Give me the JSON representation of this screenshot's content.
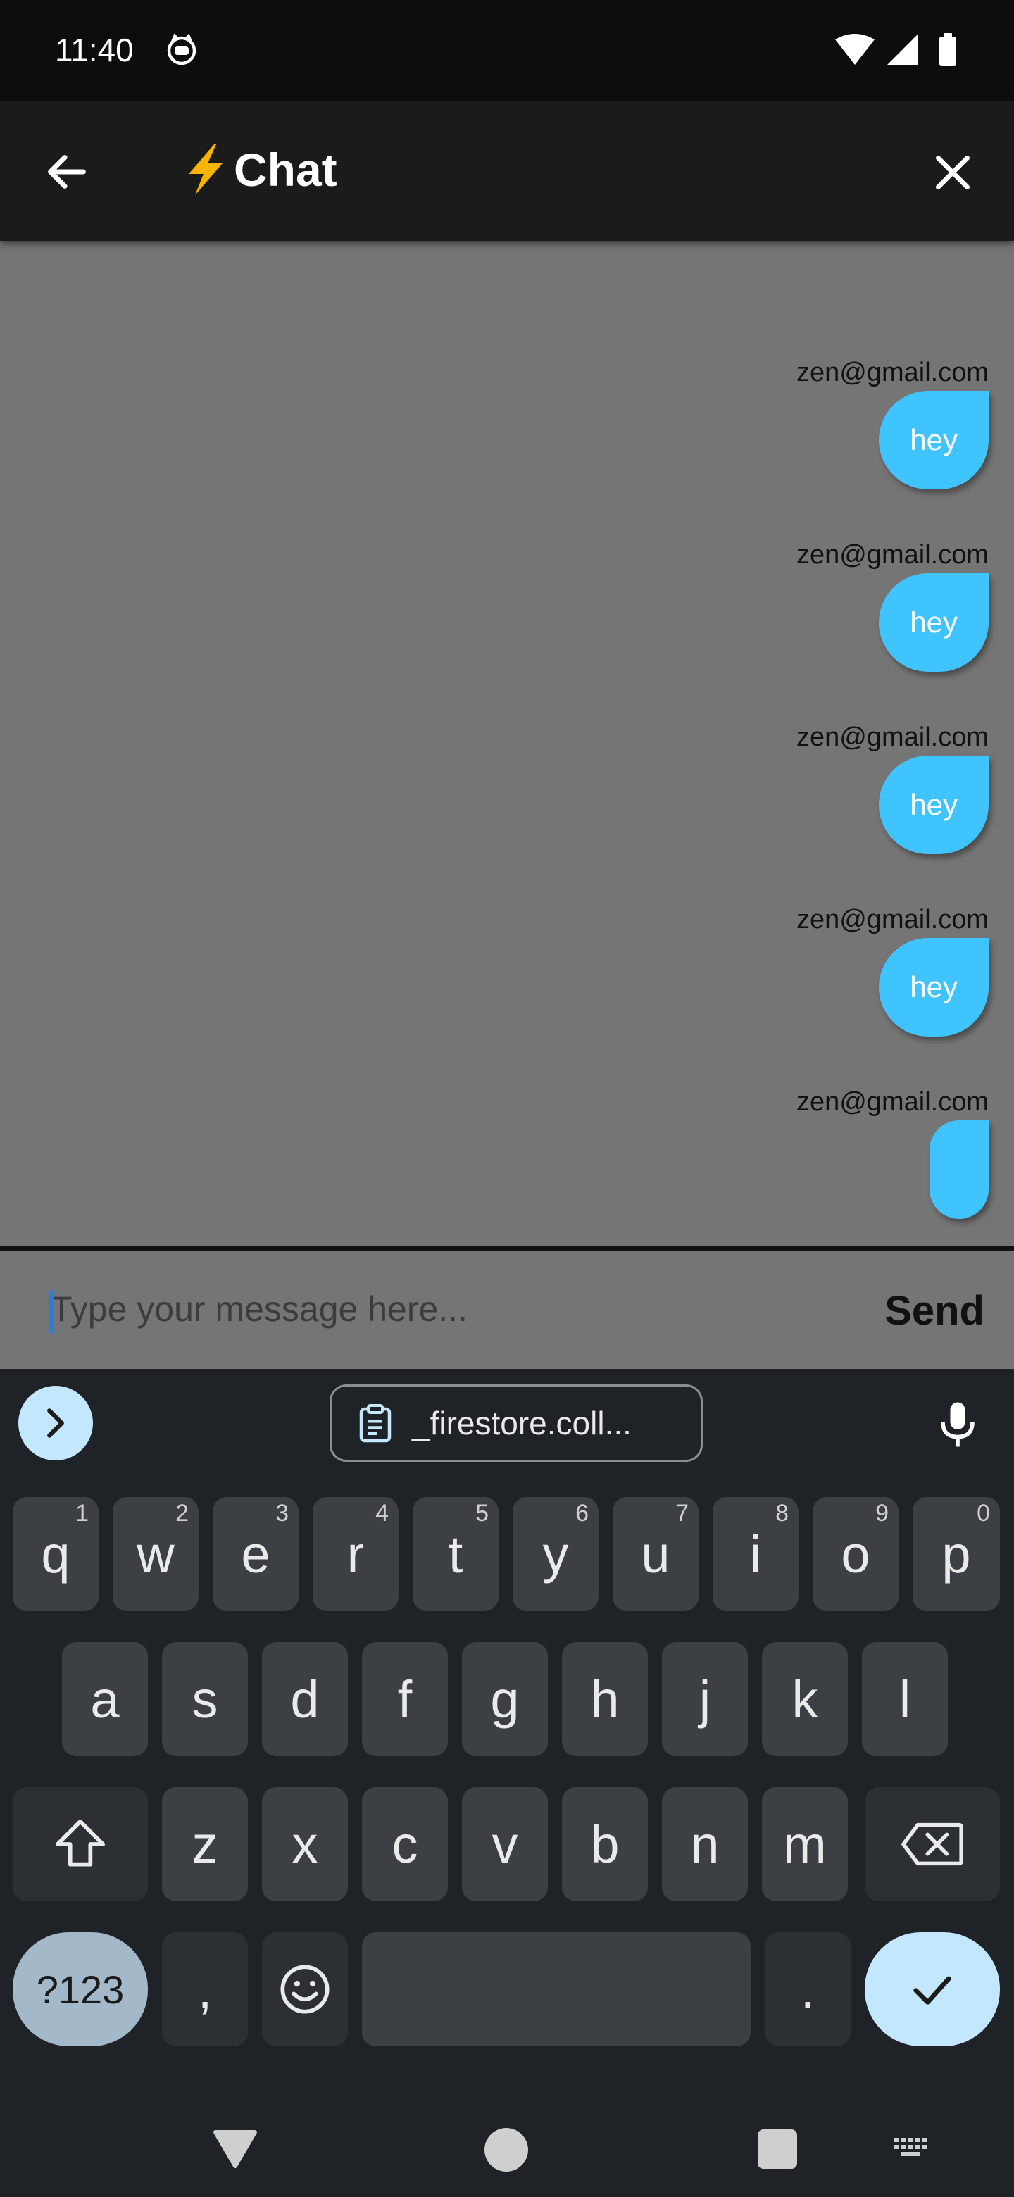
{
  "status_bar": {
    "time": "11:40"
  },
  "app_bar": {
    "title": "Chat"
  },
  "messages": [
    {
      "sender": "zen@gmail.com",
      "text": "hey"
    },
    {
      "sender": "zen@gmail.com",
      "text": "hey"
    },
    {
      "sender": "zen@gmail.com",
      "text": "hey"
    },
    {
      "sender": "zen@gmail.com",
      "text": "hey"
    },
    {
      "sender": "zen@gmail.com",
      "text": ""
    }
  ],
  "composer": {
    "placeholder": "Type your message here...",
    "send_label": "Send"
  },
  "keyboard": {
    "clipboard_suggestion": "_firestore.coll...",
    "row1": [
      {
        "key": "q",
        "hint": "1"
      },
      {
        "key": "w",
        "hint": "2"
      },
      {
        "key": "e",
        "hint": "3"
      },
      {
        "key": "r",
        "hint": "4"
      },
      {
        "key": "t",
        "hint": "5"
      },
      {
        "key": "y",
        "hint": "6"
      },
      {
        "key": "u",
        "hint": "7"
      },
      {
        "key": "i",
        "hint": "8"
      },
      {
        "key": "o",
        "hint": "9"
      },
      {
        "key": "p",
        "hint": "0"
      }
    ],
    "row2": [
      "a",
      "s",
      "d",
      "f",
      "g",
      "h",
      "j",
      "k",
      "l"
    ],
    "row3": [
      "z",
      "x",
      "c",
      "v",
      "b",
      "n",
      "m"
    ],
    "symbols_key": "?123",
    "comma_key": ",",
    "period_key": "."
  },
  "colors": {
    "bubble": "#40c4ff",
    "chat_bg": "#757575",
    "keyboard_bg": "#1f2227",
    "accent": "#c2e7ff"
  }
}
